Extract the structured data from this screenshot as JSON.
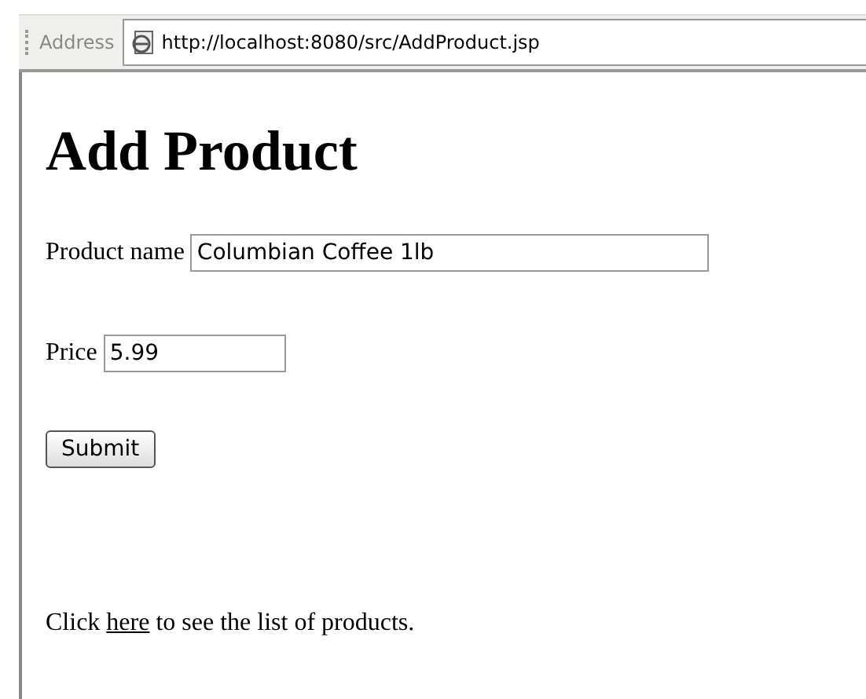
{
  "address_bar": {
    "label": "Address",
    "url": "http://localhost:8080/src/AddProduct.jsp"
  },
  "heading": "Add Product",
  "fields": [
    {
      "label": "Product name",
      "value": "Columbian Coffee 1lb",
      "kind": "wide"
    },
    {
      "label": "Price",
      "value": "5.99",
      "kind": "narrow"
    }
  ],
  "submit_button": "Submit",
  "footer": {
    "before": "Click",
    "link": "here",
    "after": "to see the list of products."
  }
}
